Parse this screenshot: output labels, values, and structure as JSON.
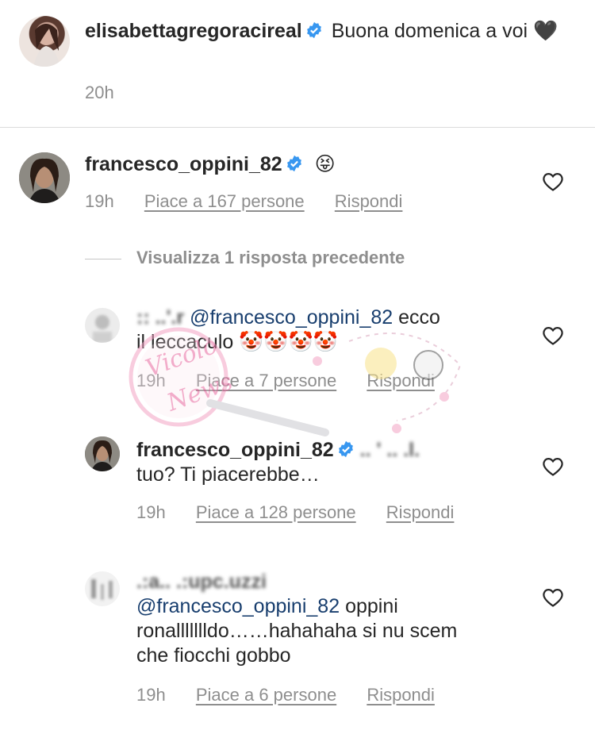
{
  "caption": {
    "username": "elisabettagregoracireal",
    "text": "Buona domenica a voi",
    "emoji": "🖤",
    "time": "20h"
  },
  "comments": [
    {
      "username": "francesco_oppini_82",
      "text": "😝",
      "time": "19h",
      "likes": "Piace a 167 persone",
      "reply": "Rispondi"
    },
    {
      "mention": "@francesco_oppini_82",
      "text_after": "ecco",
      "text_line2": "il leccaculo 🤡🤡🤡🤡",
      "time": "19h",
      "likes": "Piace a 7 persone",
      "reply": "Rispondi"
    },
    {
      "username": "francesco_oppini_82",
      "text": "tuo? Ti piacerebbe…",
      "time": "19h",
      "likes": "Piace a 128 persone",
      "reply": "Rispondi"
    },
    {
      "mention": "@francesco_oppini_82",
      "text_after": "oppini",
      "text_line2": "ronallllllldo……hahahaha si nu scem",
      "text_line3": "che fiocchi gobbo",
      "time": "19h",
      "likes": "Piace a 6 persone",
      "reply": "Rispondi"
    }
  ],
  "view_replies": "Visualizza 1 risposta precedente",
  "watermark": "Vicolo delle News",
  "colors": {
    "mention": "#183e6e",
    "verified": "#3897f0",
    "meta": "#8e8e8e",
    "divider": "#dbdbdb"
  }
}
